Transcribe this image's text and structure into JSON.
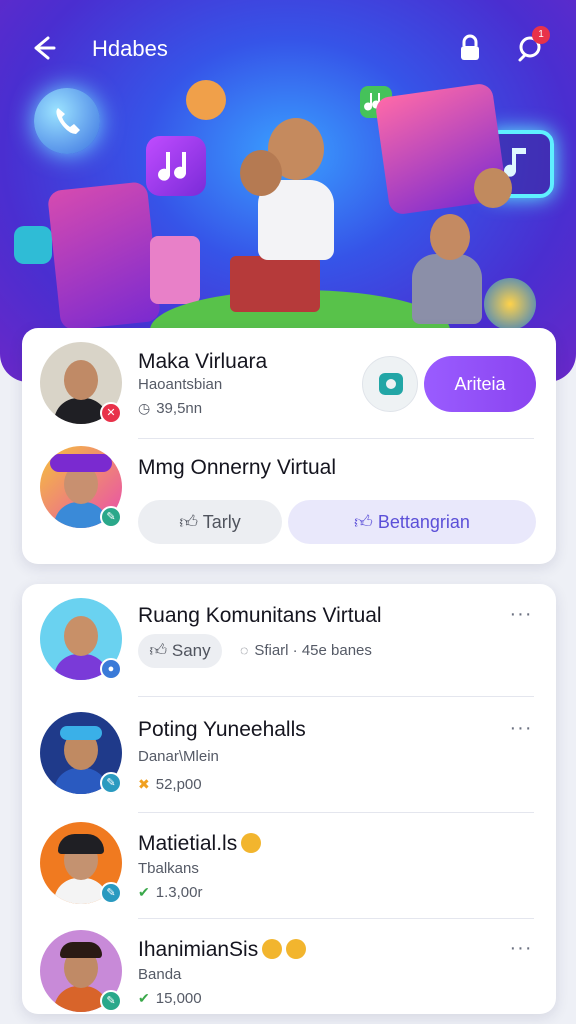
{
  "header": {
    "title": "Hdabes",
    "notification_count": "1"
  },
  "hero_icons": [
    "phone-icon",
    "music-note-icon",
    "music-note-icon",
    "music-note-icon"
  ],
  "featured": [
    {
      "name": "Maka Virluara",
      "subtitle": "Haoantsbian",
      "meta": "39,5nn",
      "meta_icon": "clock-icon",
      "action_label": "Ariteia",
      "badge_color": "#e8324a"
    },
    {
      "name": "Mmg Onnerny Virtual",
      "buttons": {
        "left_label": "Tarly",
        "right_label": "Bettangrian"
      },
      "badge_color": "#2aa88a"
    }
  ],
  "list": [
    {
      "name": "Ruang Komunitans Virtual",
      "chip_label": "Sany",
      "meta": "Sfiarl · 45e banes",
      "badge_color": "#3a7ad8"
    },
    {
      "name": "Poting Yuneehalls",
      "subtitle": "Danar\\Mlein",
      "meta": "52,p00",
      "badge_color": "#2a9ac0"
    },
    {
      "name": "Matietial.ls",
      "subtitle": "Tbalkans",
      "meta": "1.3,00r",
      "badge_color": "#2a9ac0"
    },
    {
      "name": "IhanimianSis",
      "subtitle": "Banda",
      "meta": "15,000",
      "badge_color": "#2aa88a"
    }
  ],
  "colors": {
    "accent": "#8a44f0",
    "hero_start": "#3654e8",
    "hero_end": "#6a28c8"
  }
}
